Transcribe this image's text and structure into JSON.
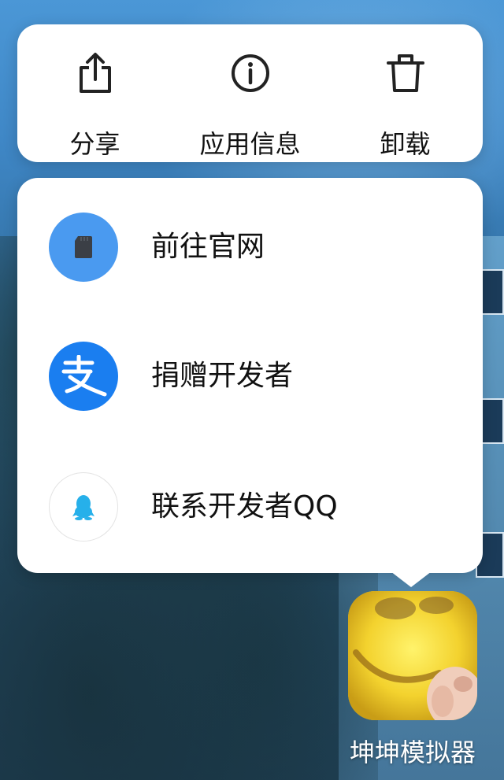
{
  "quick_actions": [
    {
      "label": "分享",
      "icon": "share-icon"
    },
    {
      "label": "应用信息",
      "icon": "info-icon"
    },
    {
      "label": "卸载",
      "icon": "trash-icon"
    }
  ],
  "menu": {
    "items": [
      {
        "label": "前往官网",
        "icon": "sd-card-icon",
        "icon_bg": "#4a9af0"
      },
      {
        "label": "捐赠开发者",
        "icon": "alipay-icon",
        "icon_bg": "#1a7ef0"
      },
      {
        "label": "联系开发者QQ",
        "icon": "qq-penguin-icon",
        "icon_bg": "#ffffff"
      }
    ]
  },
  "app": {
    "name": "坤坤模拟器",
    "icon": "app-icon-smiley"
  },
  "colors": {
    "card_bg": "#ffffff",
    "text": "#111111",
    "alipay_blue": "#1a7ef0",
    "qq_cyan": "#26b0ea"
  }
}
